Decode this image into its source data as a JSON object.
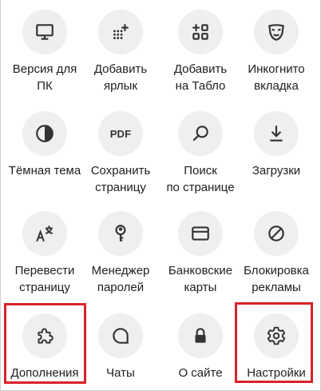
{
  "menu": {
    "row1": [
      {
        "label": "Версия для\nПК",
        "icon": "monitor-icon"
      },
      {
        "label": "Добавить\nярлык",
        "icon": "add-shortcut-icon"
      },
      {
        "label": "Добавить\nна Табло",
        "icon": "add-to-tablo-icon"
      },
      {
        "label": "Инкогнито\nвкладка",
        "icon": "incognito-mask-icon"
      }
    ],
    "row2": [
      {
        "label": "Тёмная тема",
        "icon": "dark-theme-icon"
      },
      {
        "label": "Сохранить\nстраницу",
        "icon": "pdf-icon",
        "icon_text": "PDF"
      },
      {
        "label": "Поиск\nпо странице",
        "icon": "search-icon"
      },
      {
        "label": "Загрузки",
        "icon": "download-icon"
      }
    ],
    "row3": [
      {
        "label": "Перевести\nстраницу",
        "icon": "translate-icon"
      },
      {
        "label": "Менеджер\nпаролей",
        "icon": "key-icon"
      },
      {
        "label": "Банковские\nкарты",
        "icon": "bank-card-icon"
      },
      {
        "label": "Блокировка\nрекламы",
        "icon": "ad-block-icon"
      }
    ],
    "row4": [
      {
        "label": "Дополнения",
        "icon": "puzzle-icon"
      },
      {
        "label": "Чаты",
        "icon": "chat-bubble-icon"
      },
      {
        "label": "О сайте",
        "icon": "lock-icon"
      },
      {
        "label": "Настройки",
        "icon": "gear-icon"
      }
    ]
  },
  "highlight_color": "#d9222a",
  "icon_color": "#333333",
  "circle_color": "#efefef"
}
